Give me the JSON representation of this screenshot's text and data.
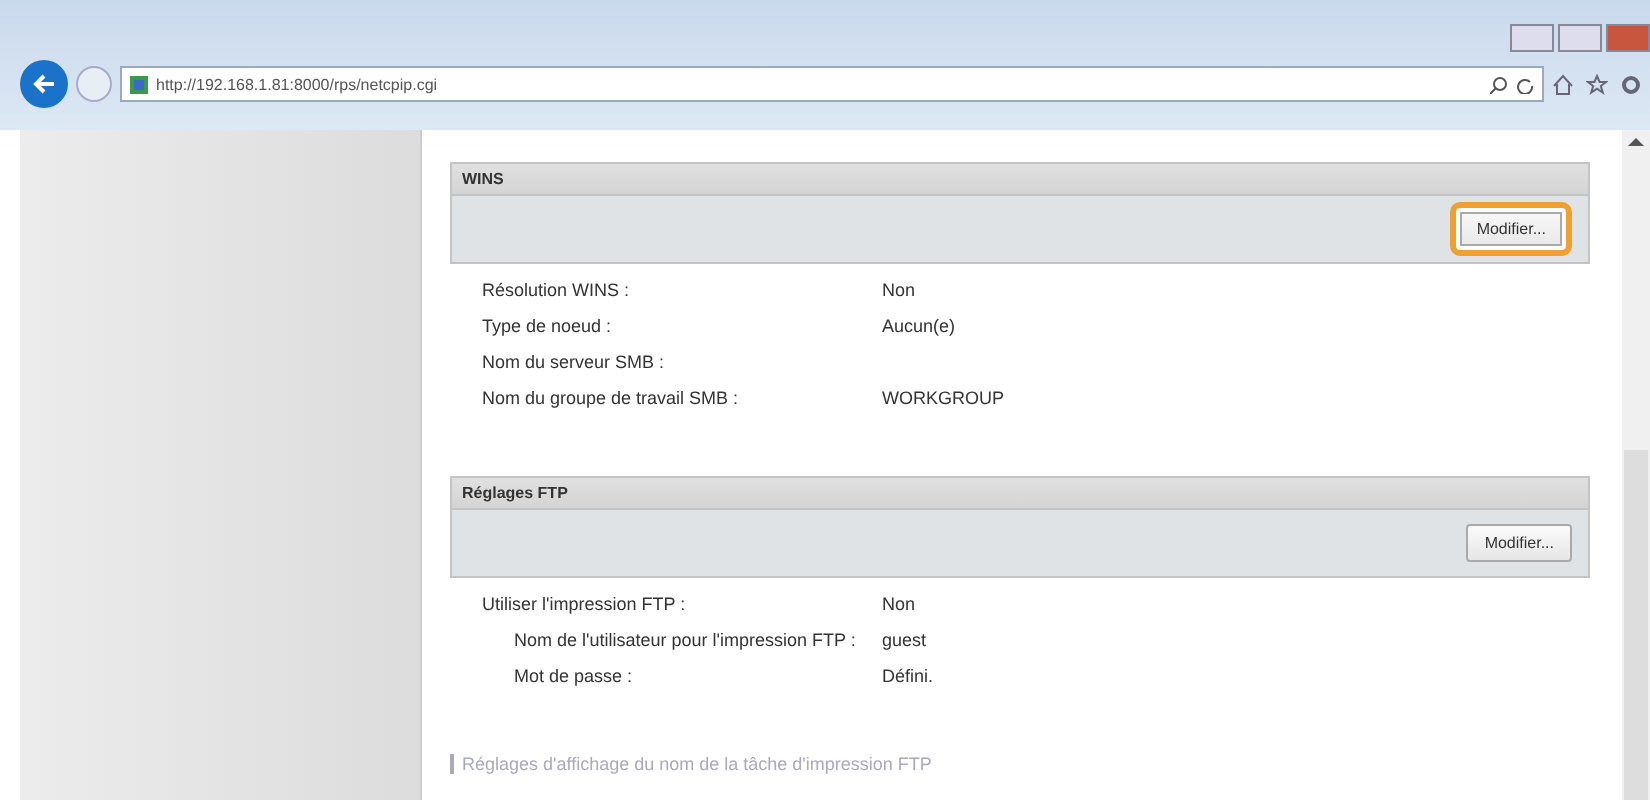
{
  "browser": {
    "url": "http://192.168.1.81:8000/rps/netcpip.cgi"
  },
  "sections": [
    {
      "title": "WINS",
      "button": {
        "label": "Modifier...",
        "highlighted": true
      },
      "rows": [
        {
          "label": "Résolution WINS :",
          "value": "Non"
        },
        {
          "label": "Type de noeud :",
          "value": "Aucun(e)"
        },
        {
          "label": "Nom du serveur SMB :"
        },
        {
          "label": "Nom du groupe de travail SMB :",
          "value": "WORKGROUP"
        }
      ]
    },
    {
      "title": "Réglages FTP",
      "button": {
        "label": "Modifier...",
        "highlighted": false
      },
      "rows": [
        {
          "label": "Utiliser l'impression FTP :",
          "value": "Non",
          "children": [
            {
              "label": "Nom de l'utilisateur pour l'impression FTP :",
              "value": "guest"
            },
            {
              "label": "Mot de passe :",
              "value": "Défini."
            }
          ]
        }
      ]
    }
  ],
  "subsection_link": "Réglages d'affichage du nom de la tâche d'impression FTP"
}
